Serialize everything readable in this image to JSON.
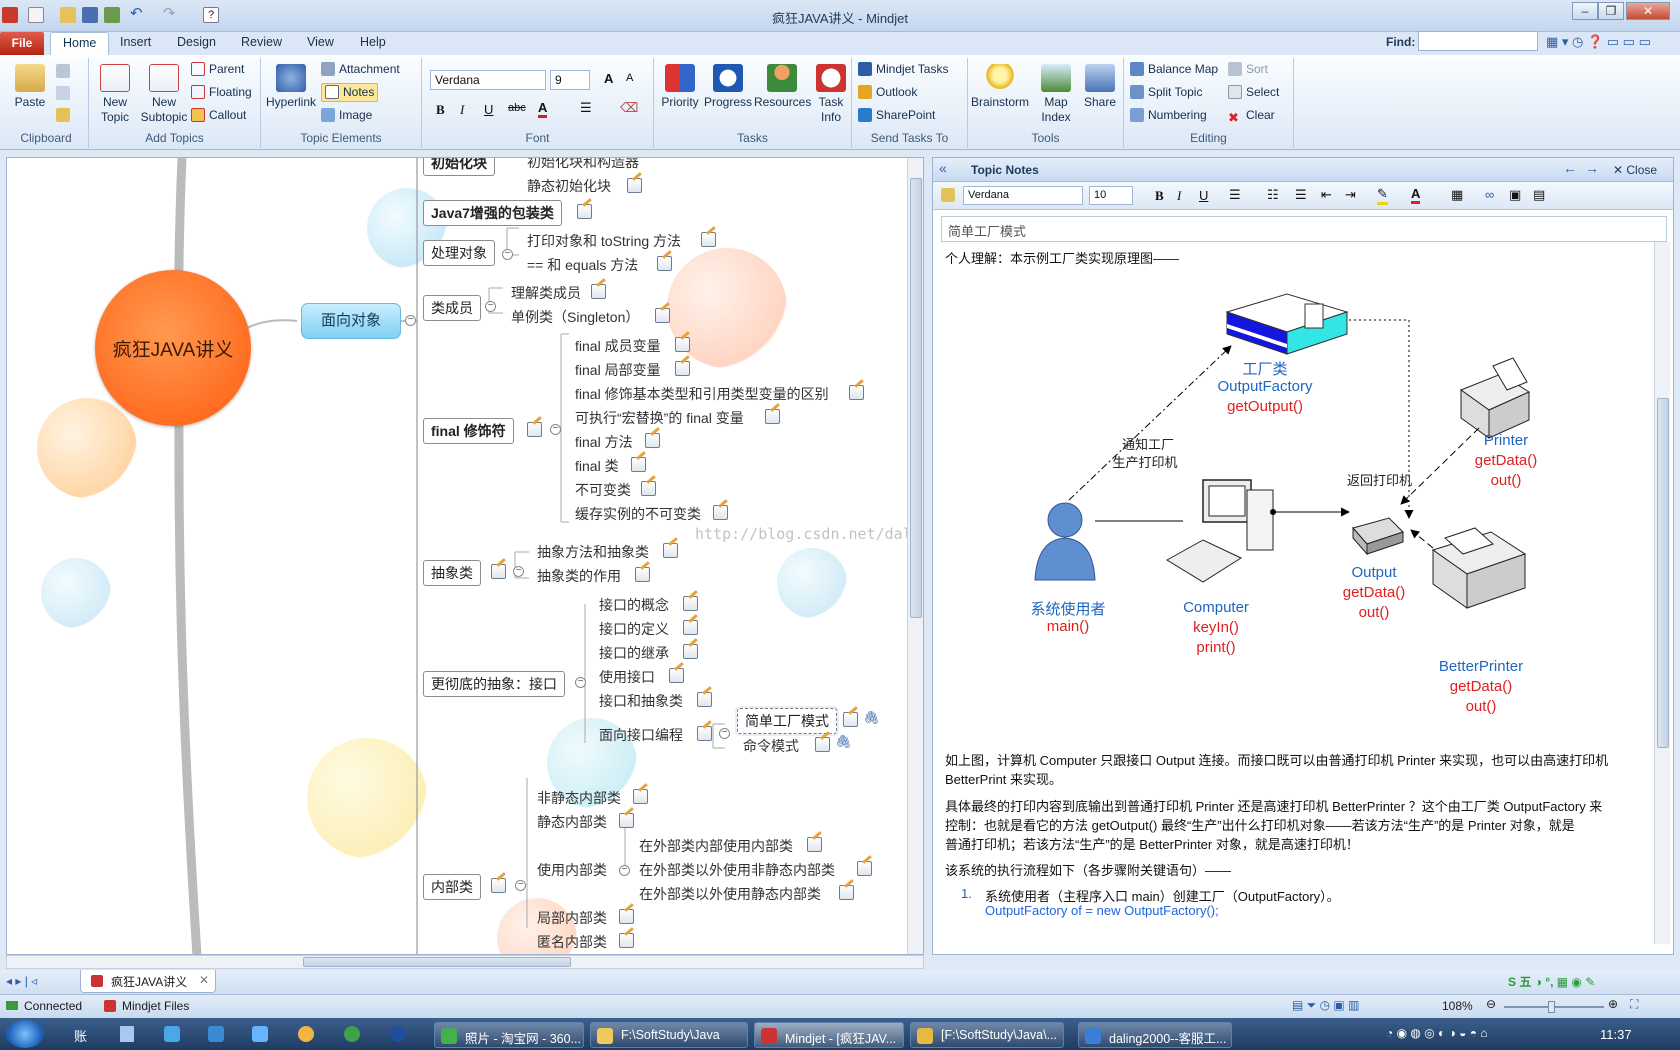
{
  "window": {
    "title": "疯狂JAVA讲义 - Mindjet"
  },
  "menu": {
    "file": "File",
    "tabs": [
      "Home",
      "Insert",
      "Design",
      "Review",
      "View",
      "Help"
    ],
    "find_label": "Find:"
  },
  "ribbon": {
    "clipboard": {
      "paste": "Paste",
      "label": "Clipboard"
    },
    "add_topics": {
      "new_topic": "New Topic",
      "new_subtopic": "New Subtopic",
      "parent": "Parent",
      "floating": "Floating",
      "callout": "Callout",
      "label": "Add Topics"
    },
    "topic_elements": {
      "hyperlink": "Hyperlink",
      "attachment": "Attachment",
      "notes": "Notes",
      "image": "Image",
      "label": "Topic Elements"
    },
    "font": {
      "family": "Verdana",
      "size": "9",
      "label": "Font"
    },
    "tasks": {
      "priority": "Priority",
      "progress": "Progress",
      "resources": "Resources",
      "task_info": "Task Info",
      "label": "Tasks"
    },
    "send_tasks": {
      "mindjet_tasks": "Mindjet Tasks",
      "outlook": "Outlook",
      "sharepoint": "SharePoint",
      "label": "Send Tasks To"
    },
    "tools": {
      "brainstorm": "Brainstorm",
      "map_index": "Map Index",
      "share": "Share",
      "label": "Tools"
    },
    "editing": {
      "balance_map": "Balance Map",
      "sort": "Sort",
      "split_topic": "Split Topic",
      "select": "Select",
      "numbering": "Numbering",
      "clear": "Clear",
      "label": "Editing"
    }
  },
  "map": {
    "central": "疯狂JAVA讲义",
    "main_topic": "面向对象",
    "top_partial": [
      "初始化块",
      "初始化块和构造器",
      "静态初始化块"
    ],
    "java7": "Java7增强的包装类",
    "handle_objects": {
      "label": "处理对象",
      "children": [
        "打印对象和 toString 方法",
        "== 和 equals 方法"
      ]
    },
    "class_members": {
      "label": "类成员",
      "children": [
        "理解类成员",
        "单例类（Singleton）"
      ]
    },
    "final_mod": {
      "label": "final 修饰符",
      "children": [
        "final 成员变量",
        "final 局部变量",
        "final 修饰基本类型和引用类型变量的区别",
        "可执行“宏替换”的 final 变量",
        "final 方法",
        "final 类",
        "不可变类",
        "缓存实例的不可变类"
      ]
    },
    "abstract_cls": {
      "label": "抽象类",
      "children": [
        "抽象方法和抽象类",
        "抽象类的作用"
      ]
    },
    "interface": {
      "label": "更彻底的抽象：接口",
      "children": [
        "接口的概念",
        "接口的定义",
        "接口的继承",
        "使用接口",
        "接口和抽象类",
        "面向接口编程"
      ],
      "patterns": [
        "简单工厂模式",
        "命令模式"
      ]
    },
    "inner": {
      "label": "内部类",
      "children": [
        "非静态内部类",
        "静态内部类",
        "使用内部类",
        "局部内部类",
        "匿名内部类"
      ],
      "use_children": [
        "在外部类内部使用内部类",
        "在外部类以外使用非静态内部类",
        "在外部类以外使用静态内部类"
      ]
    },
    "watermark": "http://blog.csdn.net/daling2000"
  },
  "notes": {
    "header": "Topic Notes",
    "close": "Close",
    "font": "Verdana",
    "size": "10",
    "subject": "简单工厂模式",
    "intro": "个人理解：本示例工厂类实现原理图——",
    "diagram": {
      "factory": [
        "工厂类",
        "OutputFactory",
        "getOutput()"
      ],
      "notify": [
        "通知工厂",
        "生产打印机"
      ],
      "return": "返回打印机",
      "printer": [
        "Printer",
        "getData()",
        "out()"
      ],
      "user": [
        "系统使用者",
        "main()"
      ],
      "computer": [
        "Computer",
        "keyIn()",
        "print()"
      ],
      "output": [
        "Output",
        "getData()",
        "out()"
      ],
      "better": [
        "BetterPrinter",
        "getData()",
        "out()"
      ]
    },
    "para1": [
      "如上图，计算机 Computer 只跟接口 Output 连接。而接口既可以由普通打印机 Printer 来实现，也可以由高速打印机",
      "BetterPrint 来实现。"
    ],
    "para2": [
      "具体最终的打印内容到底输出到普通打印机 Printer 还是高速打印机 BetterPrinter ？这个由工厂类 OutputFactory 来",
      "控制：也就是看它的方法 getOutput() 最终“生产”出什么打印机对象——若该方法“生产”的是 Printer 对象，就是",
      "普通打印机；若该方法“生产”的是 BetterPrinter 对象，就是高速打印机！"
    ],
    "para3": "该系统的执行流程如下（各步骤附关键语句）——",
    "step1": "系统使用者（主程序入口 main）创建工厂（OutputFactory）。",
    "step1_code": "OutputFactory of = new OutputFactory();",
    "step_num": "1."
  },
  "bottom": {
    "doc_tab": "疯狂JAVA讲义",
    "status": "Connected",
    "files": "Mindjet Files",
    "zoom": "108%"
  },
  "taskbar": {
    "items": [
      "账",
      "照片 - 淘宝网 - 360...",
      "F:\\SoftStudy\\Java",
      "Mindjet - [疯狂JAV...",
      "[F:\\SoftStudy\\Java\\...",
      "daling2000--客服工..."
    ],
    "ime": "五",
    "time": "11:37"
  }
}
